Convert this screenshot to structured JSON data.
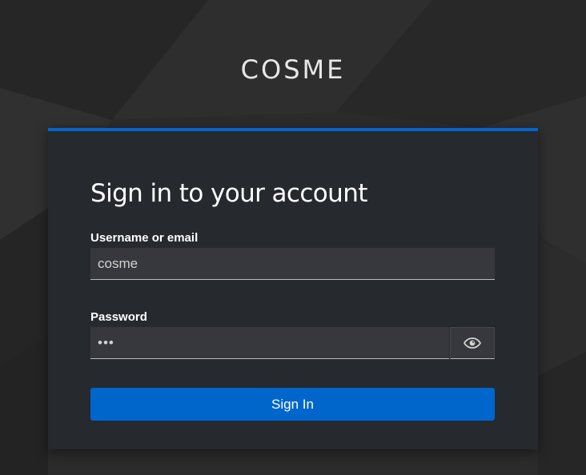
{
  "brand": {
    "name": "COSME"
  },
  "form": {
    "title": "Sign in to your account",
    "username_label": "Username or email",
    "username_value": "cosme",
    "password_label": "Password",
    "password_value": "•••",
    "show_password_icon": "eye-icon",
    "submit_label": "Sign In"
  },
  "colors": {
    "accent": "#0066cc",
    "page_background": "#2a2a2a",
    "card_background": "#26292e",
    "input_background": "#36383d"
  }
}
